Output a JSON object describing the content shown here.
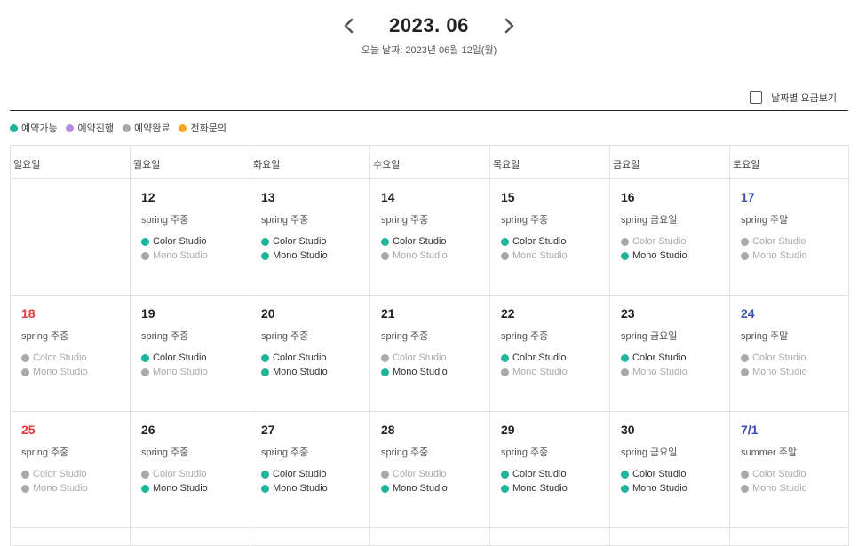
{
  "header": {
    "month_title": "2023. 06",
    "today_label": "오늘 날짜:",
    "today_value": "2023년 06월 12일(월)"
  },
  "price_toggle": {
    "label": "날짜별 요금보기",
    "checked": false
  },
  "legend": [
    {
      "label": "예약가능",
      "color": "#1fb59b"
    },
    {
      "label": "예약진행",
      "color": "#b28be0"
    },
    {
      "label": "예약완료",
      "color": "#a9a9a9"
    },
    {
      "label": "전화문의",
      "color": "#f5a623"
    }
  ],
  "weekdays": [
    "일요일",
    "월요일",
    "화요일",
    "수요일",
    "목요일",
    "금요일",
    "토요일"
  ],
  "weeks": [
    [
      {
        "empty": true
      },
      {
        "date": "12",
        "season": "spring 주중",
        "color": "available",
        "mono": "done"
      },
      {
        "date": "13",
        "season": "spring 주중",
        "color": "available",
        "mono": "available"
      },
      {
        "date": "14",
        "season": "spring 주중",
        "color": "available",
        "mono": "done"
      },
      {
        "date": "15",
        "season": "spring 주중",
        "color": "available",
        "mono": "done"
      },
      {
        "date": "16",
        "season": "spring 금요일",
        "color": "done",
        "mono": "available"
      },
      {
        "date": "17",
        "season": "spring 주말",
        "color": "done",
        "mono": "done"
      }
    ],
    [
      {
        "date": "18",
        "season": "spring 주중",
        "color": "done",
        "mono": "done"
      },
      {
        "date": "19",
        "season": "spring 주중",
        "color": "available",
        "mono": "done"
      },
      {
        "date": "20",
        "season": "spring 주중",
        "color": "available",
        "mono": "available"
      },
      {
        "date": "21",
        "season": "spring 주중",
        "color": "done",
        "mono": "available"
      },
      {
        "date": "22",
        "season": "spring 주중",
        "color": "available",
        "mono": "done"
      },
      {
        "date": "23",
        "season": "spring 금요일",
        "color": "available",
        "mono": "done"
      },
      {
        "date": "24",
        "season": "spring 주말",
        "color": "done",
        "mono": "done"
      }
    ],
    [
      {
        "date": "25",
        "season": "spring 주중",
        "color": "done",
        "mono": "done"
      },
      {
        "date": "26",
        "season": "spring 주중",
        "color": "done",
        "mono": "available"
      },
      {
        "date": "27",
        "season": "spring 주중",
        "color": "available",
        "mono": "available"
      },
      {
        "date": "28",
        "season": "spring 주중",
        "color": "done",
        "mono": "available"
      },
      {
        "date": "29",
        "season": "spring 주중",
        "color": "available",
        "mono": "available"
      },
      {
        "date": "30",
        "season": "spring 금요일",
        "color": "available",
        "mono": "available"
      },
      {
        "date": "7/1",
        "season": "summer 주말",
        "color": "done",
        "mono": "done"
      }
    ]
  ],
  "studio_names": {
    "color": "Color Studio",
    "mono": "Mono Studio"
  }
}
